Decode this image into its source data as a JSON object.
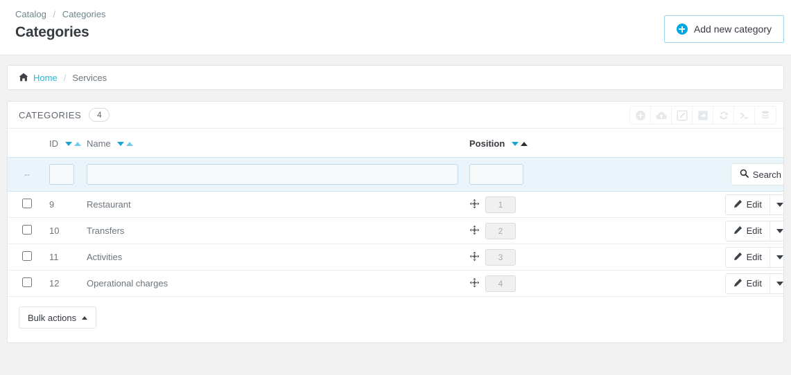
{
  "header": {
    "breadcrumb": [
      "Catalog",
      "Categories"
    ],
    "breadcrumb_separator": "/",
    "title": "Categories",
    "add_button": "Add new category"
  },
  "nav_breadcrumb": {
    "home_label": "Home",
    "separator": "/",
    "current": "Services"
  },
  "panel": {
    "title": "CATEGORIES",
    "count": "4",
    "tools": [
      "add-icon",
      "cloud-upload-icon",
      "edit-square-icon",
      "export-share-icon",
      "refresh-icon",
      "terminal-icon",
      "database-icon"
    ]
  },
  "table": {
    "columns": [
      {
        "key": "checkbox",
        "label": ""
      },
      {
        "key": "id",
        "label": "ID",
        "sortable": true
      },
      {
        "key": "name",
        "label": "Name",
        "sortable": true
      },
      {
        "key": "position",
        "label": "Position",
        "sortable": true,
        "active_sort": "asc"
      },
      {
        "key": "actions",
        "label": ""
      }
    ],
    "filter_row": {
      "dash": "--",
      "id_value": "",
      "name_value": "",
      "position_value": "",
      "search_label": "Search"
    },
    "rows": [
      {
        "id": "9",
        "name": "Restaurant",
        "position": "1",
        "action": "Edit"
      },
      {
        "id": "10",
        "name": "Transfers",
        "position": "2",
        "action": "Edit"
      },
      {
        "id": "11",
        "name": "Activities",
        "position": "3",
        "action": "Edit"
      },
      {
        "id": "12",
        "name": "Operational charges",
        "position": "4",
        "action": "Edit"
      }
    ]
  },
  "footer": {
    "bulk_actions": "Bulk actions"
  },
  "colors": {
    "accent_blue": "#00a7e1",
    "link_teal": "#25b9d7",
    "sort_blue": "#19a5d4",
    "filter_bg": "#eaf4fb",
    "page_bg": "#f1f1f1",
    "text": "#363a41",
    "muted": "#6c757d"
  }
}
